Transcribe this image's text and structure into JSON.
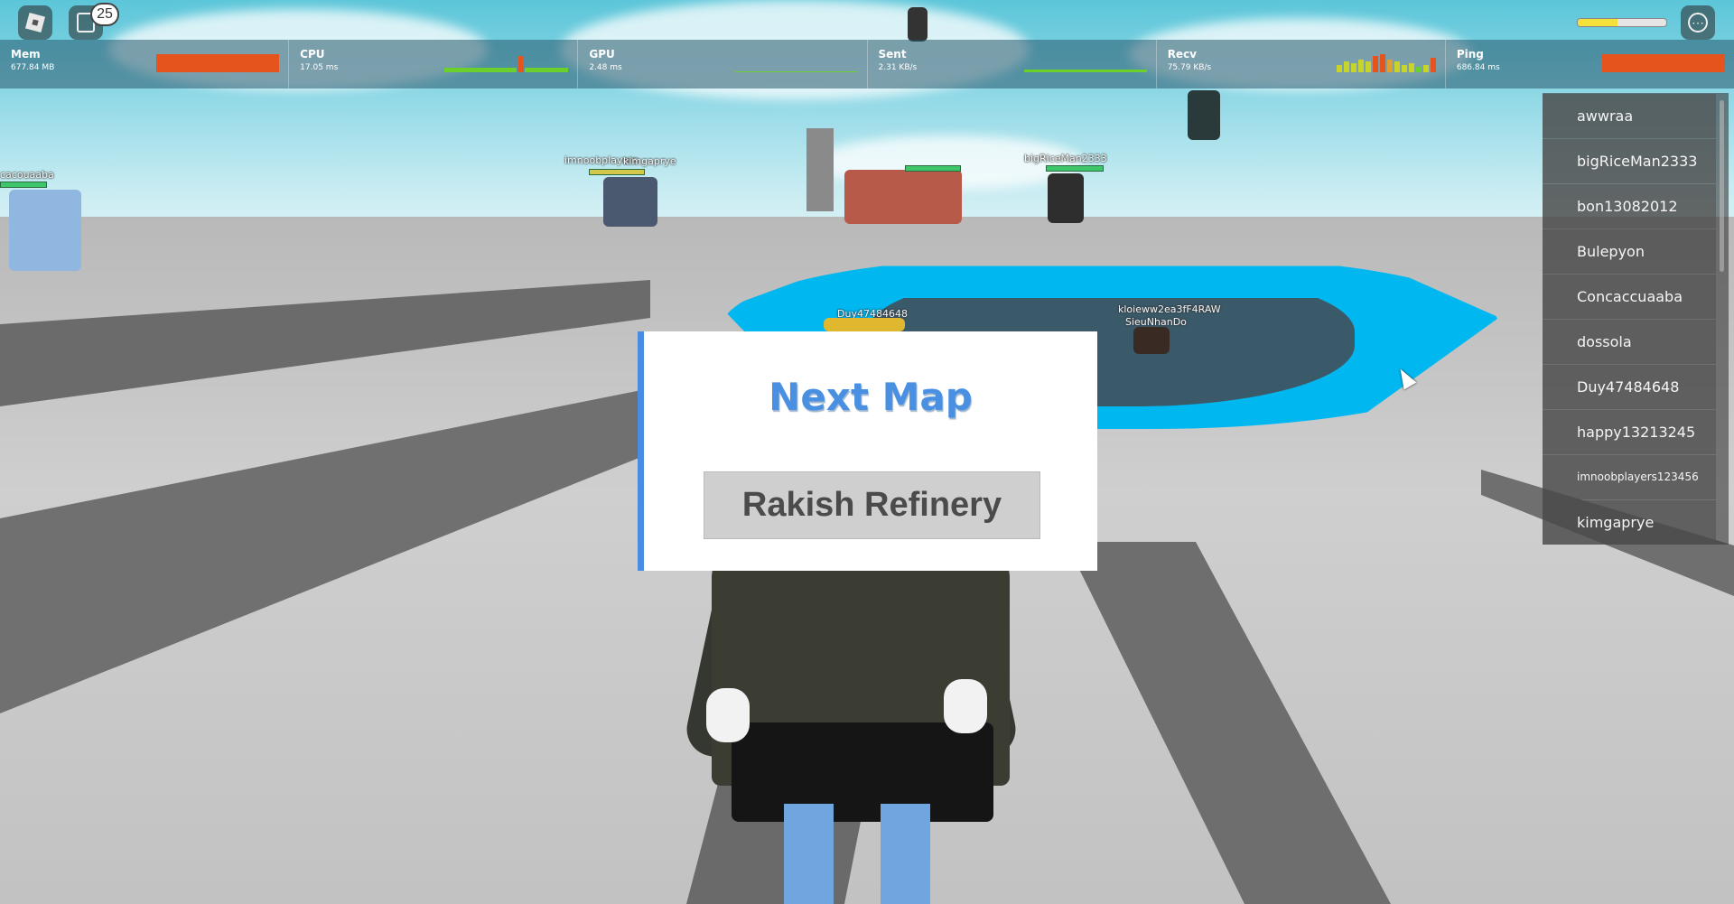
{
  "topbar": {
    "chat_badge_count": "25",
    "health_fraction": 0.45
  },
  "stats": [
    {
      "name": "Mem",
      "value": "677.84 MB"
    },
    {
      "name": "CPU",
      "value": "17.05 ms"
    },
    {
      "name": "GPU",
      "value": "2.48 ms"
    },
    {
      "name": "Sent",
      "value": "2.31 KB/s"
    },
    {
      "name": "Recv",
      "value": "75.79 KB/s"
    },
    {
      "name": "Ping",
      "value": "686.84 ms"
    }
  ],
  "dialog": {
    "title": "Next Map",
    "map_name": "Rakish Refinery"
  },
  "players": [
    "awwraa",
    "bigRiceMan2333",
    "bon13082012",
    "Bulepyon",
    "Concaccuaaba",
    "dossola",
    "Duy47484648",
    "happy13213245",
    "imnoobplayers123456",
    "kimgaprye"
  ],
  "nametags": {
    "left": "cacouaaba",
    "group1": "imnoobplayers",
    "group2": "kimgaprye",
    "group3": "bigRiceMan2333",
    "duy": "Duy47484648",
    "kloieww": "kloieww2ea3fF4RAW",
    "sieu": "SieuNhanDo"
  },
  "colors": {
    "accent": "#4a90e2",
    "stat_bar": "#e6541e",
    "stat_line": "#6bd02b",
    "pit": "#00b7f0"
  }
}
